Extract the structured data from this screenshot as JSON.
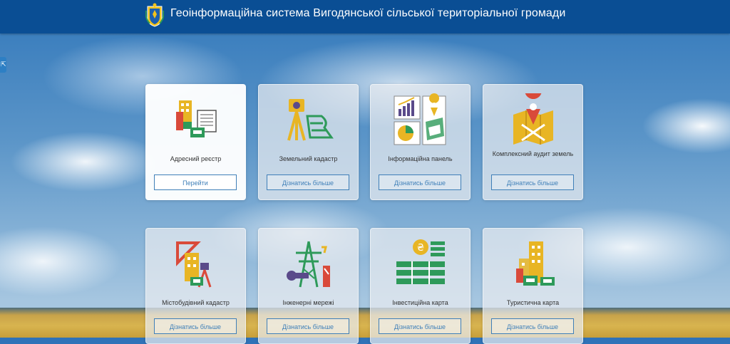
{
  "header": {
    "title": "Геоінформаційна система Вигодянської сільської територіальної громади",
    "logo_icon": "coat-of-arms-icon"
  },
  "side_tab": {
    "icon": "expand-arrow-icon",
    "glyph": "⇱"
  },
  "cards": [
    {
      "label": "Адресний реєстр",
      "button": "Перейти",
      "icon": "address-registry-icon"
    },
    {
      "label": "Земельний кадастр",
      "button": "Дізнатись більше",
      "icon": "land-cadastre-icon"
    },
    {
      "label": "Інформаційна панель",
      "button": "Дізнатись більше",
      "icon": "dashboard-icon"
    },
    {
      "label": "Комплексний аудит земель",
      "button": "Дізнатись більше",
      "icon": "land-audit-icon"
    },
    {
      "label": "Містобудівний кадастр",
      "button": "Дізнатись більше",
      "icon": "urban-cadastre-icon"
    },
    {
      "label": "Інженерні мережі",
      "button": "Дізнатись більше",
      "icon": "engineering-networks-icon"
    },
    {
      "label": "Інвестиційна карта",
      "button": "Дізнатись більше",
      "icon": "investment-map-icon"
    },
    {
      "label": "Туристична карта",
      "button": "Дізнатись більше",
      "icon": "tourist-map-icon"
    }
  ],
  "colors": {
    "header_bg": "#0a4e94",
    "button_border": "#3f7fb8",
    "icon_yellow": "#e8b524",
    "icon_green": "#2e9a5a",
    "icon_purple": "#5a4a8a",
    "icon_red": "#d94a3a"
  }
}
